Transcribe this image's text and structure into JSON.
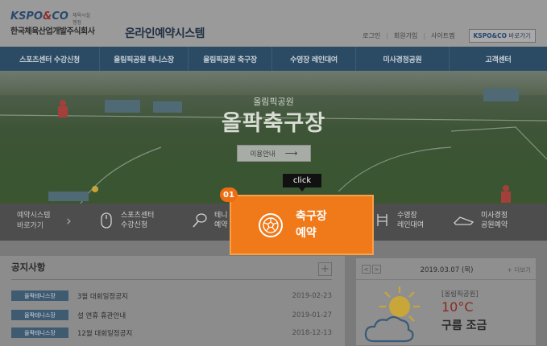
{
  "header": {
    "logo_kspo": "KSPO",
    "logo_amp": "&",
    "logo_co": "CO",
    "logo_sub": "체육시설행정",
    "company_name": "한국체육산업개발주식회사",
    "site_title": "온라인예약시스템",
    "util_links": [
      "로그인",
      "회원가입",
      "사이트맵"
    ],
    "kspo_link_brand": "KSPO&CO",
    "kspo_link_suffix": " 바로가기"
  },
  "nav": {
    "items": [
      "스포츠센터 수강신청",
      "올림픽공원 테니스장",
      "올림픽공원 축구장",
      "수영장 레인대여",
      "미사경정공원",
      "고객센터"
    ]
  },
  "hero": {
    "subtitle": "올림픽공원",
    "title": "올팍축구장",
    "button_label": "이용안내",
    "button_arrow": "⟶"
  },
  "quickbar": {
    "intro_line1": "예약시스템",
    "intro_line2": "바로가기",
    "items": [
      {
        "line1": "스포츠센터",
        "line2": "수강신청",
        "icon": "mouse-icon"
      },
      {
        "line1": "테니",
        "line2": "예약",
        "icon": "tennis-racket-icon"
      },
      {
        "line1": "수영장",
        "line2": "레인대여",
        "icon": "swimming-icon"
      },
      {
        "line1": "미사경정",
        "line2": "공원예약",
        "icon": "boat-icon"
      }
    ]
  },
  "highlight": {
    "step": "01",
    "tooltip": "click",
    "line1": "축구장",
    "line2": "예약",
    "icon": "soccer-ball-icon"
  },
  "notice": {
    "title": "공지사항",
    "more": "+",
    "rows": [
      {
        "tag": "올팍테니스장",
        "title": "3월 대회일정공지",
        "date": "2019-02-23"
      },
      {
        "tag": "올팍테니스장",
        "title": "설 연휴 휴관안내",
        "date": "2019-01-27"
      },
      {
        "tag": "올팍테니스장",
        "title": "12월 대회일정공지",
        "date": "2018-12-13"
      }
    ]
  },
  "weather": {
    "prev": "<",
    "next": ">",
    "date": "2019.03.07 (목)",
    "more": "+ 더보기",
    "location": "[올림픽공원]",
    "temperature": "10°C",
    "condition": "구름 조금",
    "icon": "sun-cloud-icon"
  }
}
